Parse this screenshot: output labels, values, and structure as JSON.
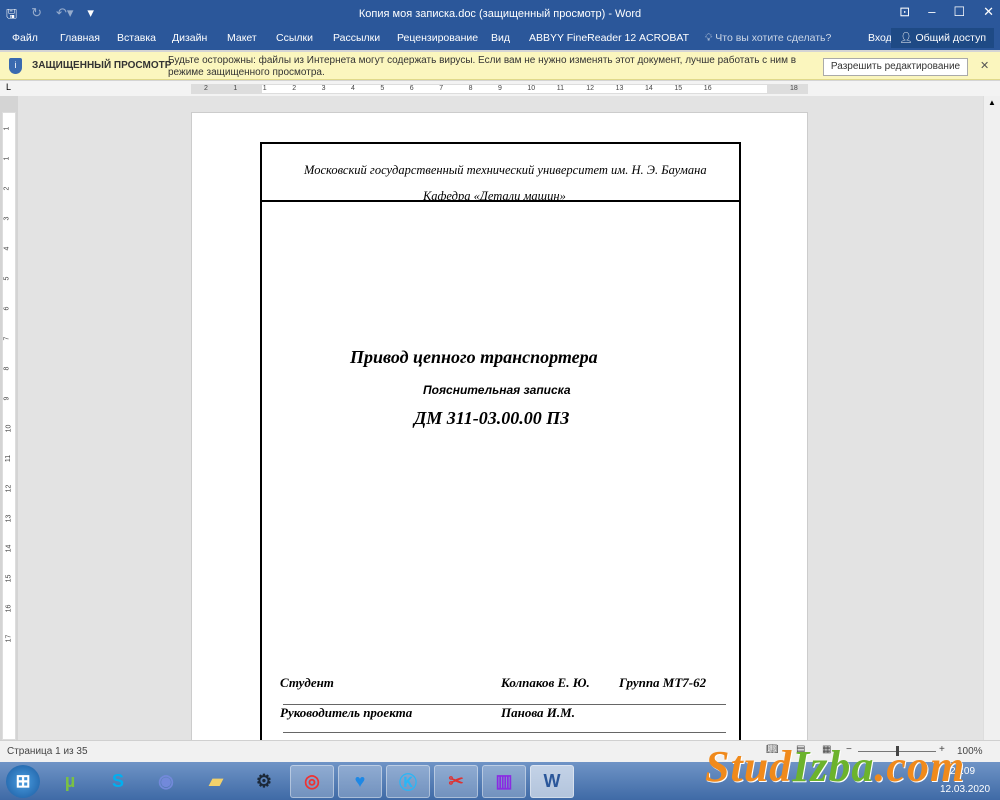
{
  "window": {
    "title": "Копия моя записка.doc (защищенный просмотр) - Word"
  },
  "menu": {
    "tabs": [
      "Файл",
      "Главная",
      "Вставка",
      "Дизайн",
      "Макет",
      "Ссылки",
      "Рассылки",
      "Рецензирование",
      "Вид",
      "ABBYY FineReader 12",
      "ACROBAT"
    ],
    "tell_me": "Что вы хотите сделать?",
    "signin": "Вход",
    "share": "Общий доступ"
  },
  "protected_view": {
    "label": "ЗАЩИЩЕННЫЙ ПРОСМОТР",
    "message": "Будьте осторожны: файлы из Интернета могут содержать вирусы. Если вам не нужно изменять этот документ, лучше работать с ним в режиме защищенного просмотра.",
    "button": "Разрешить редактирование"
  },
  "ruler": {
    "ticks": [
      "2",
      "1",
      "1",
      "2",
      "3",
      "4",
      "5",
      "6",
      "7",
      "8",
      "9",
      "10",
      "11",
      "12",
      "13",
      "14",
      "15",
      "16",
      "18"
    ],
    "vticks": [
      "1",
      "1",
      "2",
      "3",
      "4",
      "5",
      "6",
      "7",
      "8",
      "9",
      "10",
      "11",
      "12",
      "13",
      "14",
      "15",
      "16",
      "17"
    ]
  },
  "document": {
    "university": "Московский государственный технический университет им. Н. Э. Баумана",
    "department": "Кафедра «Детали машин»",
    "title": "Привод цепного транспортера",
    "subtitle": "Пояснительная записка",
    "code": "ДМ 311-03.00.00 ПЗ",
    "student_label": "Студент",
    "student_name": "Колпаков Е. Ю.",
    "group": "Группа МТ7-62",
    "supervisor_label": "Руководитель проекта",
    "supervisor_name": "Панова И.М."
  },
  "status": {
    "page": "Страница 1 из 35",
    "zoom": "100%"
  },
  "taskbar": {
    "time": "21:09",
    "date": "12.03.2020"
  },
  "watermark": {
    "text1": "Stud",
    "text2": "Izba",
    ".com": ".com"
  },
  "colors": {
    "accent": "#2b579a",
    "banner": "#fbf6be"
  }
}
